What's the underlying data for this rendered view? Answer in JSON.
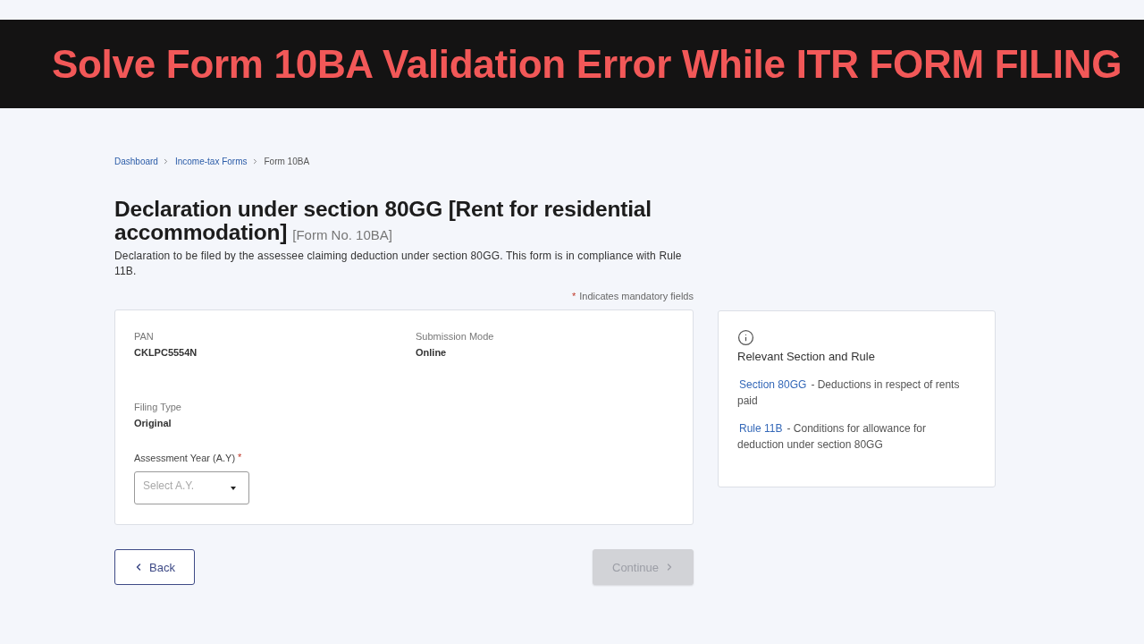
{
  "banner": {
    "title": "Solve Form 10BA Validation Error While ITR FORM FILING"
  },
  "breadcrumb": [
    {
      "label": "Dashboard",
      "kind": "link"
    },
    {
      "label": "Income-tax Forms",
      "kind": "link"
    },
    {
      "label": "Form 10BA",
      "kind": "current"
    }
  ],
  "heading": {
    "title": "Declaration under section 80GG [Rent for residential accommodation]",
    "form_no": "[Form No. 10BA]",
    "description": "Declaration to be filed by the assessee claiming deduction under section 80GG. This form is in compliance with Rule 11B."
  },
  "mandatory_note": {
    "mark": "*",
    "text": "Indicates mandatory fields"
  },
  "form": {
    "fields": [
      {
        "kind": "info",
        "label": "PAN",
        "value": "CKLPC5554N"
      },
      {
        "kind": "info",
        "label": "Submission Mode",
        "value": "Online"
      },
      {
        "kind": "info",
        "label": "Filing Type",
        "value": "Original"
      },
      {
        "kind": "select",
        "label": "Assessment Year (A.Y)",
        "required": true,
        "placeholder": "Select A.Y."
      }
    ]
  },
  "info_panel": {
    "title": "Relevant Section and Rule",
    "items": [
      {
        "link": "Section 80GG",
        "text": "- Deductions in respect of rents paid"
      },
      {
        "link": "Rule 11B",
        "text": "- Conditions for allowance for deduction under section 80GG"
      }
    ]
  },
  "buttons": [
    {
      "kind": "back",
      "label": "Back",
      "disabled": false
    },
    {
      "kind": "continue",
      "label": "Continue",
      "disabled": true
    }
  ]
}
